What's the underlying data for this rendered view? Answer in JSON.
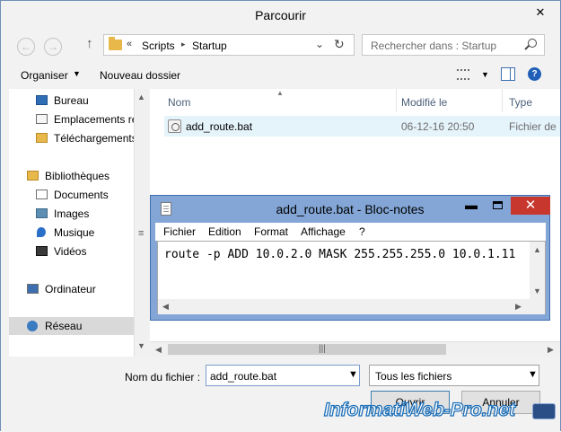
{
  "dialog": {
    "title": "Parcourir",
    "close_glyph": "✕"
  },
  "nav": {
    "back_glyph": "←",
    "forward_glyph": "→",
    "up_glyph": "↑",
    "address": {
      "prefix": "«",
      "crumbs": [
        "Scripts",
        "Startup"
      ],
      "separator": "▸",
      "dropdown_glyph": "⌄",
      "refresh_glyph": "↻"
    },
    "search_placeholder": "Rechercher dans : Startup"
  },
  "toolbar": {
    "organise_label": "Organiser",
    "caret_glyph": "▼",
    "new_folder_label": "Nouveau dossier",
    "help_glyph": "?"
  },
  "sidebar": {
    "items": [
      {
        "label": "Bureau",
        "icon": "desktop-icon"
      },
      {
        "label": "Emplacements récents",
        "icon": "recent-places-icon"
      },
      {
        "label": "Téléchargements",
        "icon": "downloads-folder-icon"
      },
      {
        "label": "Bibliothèques",
        "icon": "libraries-icon"
      },
      {
        "label": "Documents",
        "icon": "documents-icon"
      },
      {
        "label": "Images",
        "icon": "images-icon"
      },
      {
        "label": "Musique",
        "icon": "music-icon"
      },
      {
        "label": "Vidéos",
        "icon": "videos-icon"
      },
      {
        "label": "Ordinateur",
        "icon": "computer-icon"
      },
      {
        "label": "Réseau",
        "icon": "network-icon"
      }
    ],
    "scroll_up_glyph": "▲",
    "scroll_down_glyph": "▼",
    "grip_glyph": "≡"
  },
  "files": {
    "columns": [
      "Nom",
      "Modifié le",
      "Type"
    ],
    "sort_glyph": "▲",
    "rows": [
      {
        "name": "add_route.bat",
        "modified": "06-12-16 20:50",
        "type": "Fichier de"
      }
    ],
    "hscroll_left_glyph": "◀",
    "hscroll_right_glyph": "▶",
    "hscroll_grip_glyph": "|||"
  },
  "notepad": {
    "title": "add_route.bat - Bloc-notes",
    "min_glyph": "▬",
    "close_glyph": "✕",
    "menu": [
      "Fichier",
      "Edition",
      "Format",
      "Affichage",
      "?"
    ],
    "content": "route -p ADD 10.0.2.0 MASK 255.255.255.0 10.0.1.11",
    "up_glyph": "▲",
    "down_glyph": "▼",
    "left_glyph": "◀",
    "right_glyph": "▶"
  },
  "footer": {
    "filename_label": "Nom du fichier :",
    "filename_value": "add_route.bat",
    "filetype_value": "Tous les fichiers",
    "dropdown_glyph": "▼",
    "open_label": "Ouvrir",
    "cancel_label": "Annuler"
  },
  "watermark": {
    "text": "InformatiWeb-Pro.net"
  },
  "colors": {
    "accent": "#3c7fb1",
    "selection": "#e5f3fb",
    "close_red": "#c7372d",
    "notepad_frame": "#83a6d6"
  }
}
